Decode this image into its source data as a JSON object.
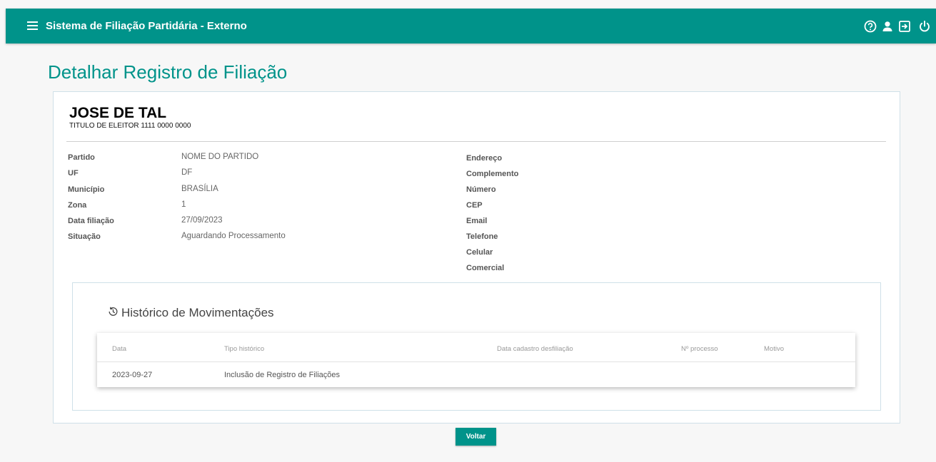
{
  "header": {
    "title": "Sistema de Filiação Partidária - Externo",
    "icons": [
      "menu-icon",
      "help-icon",
      "user-icon",
      "exit-icon",
      "power-icon"
    ]
  },
  "page": {
    "title": "Detalhar Registro de Filiação"
  },
  "person": {
    "name": "JOSE DE TAL",
    "doc": "TITULO DE ELEITOR 1111 0000 0000"
  },
  "details_left": [
    {
      "label": "Partido",
      "value": "NOME DO PARTIDO"
    },
    {
      "label": "UF",
      "value": "DF"
    },
    {
      "label": "Município",
      "value": "BRASÍLIA"
    },
    {
      "label": "Zona",
      "value": "1"
    },
    {
      "label": "Data filiação",
      "value": "27/09/2023"
    },
    {
      "label": "Situação",
      "value": "Aguardando Processamento"
    }
  ],
  "details_right": [
    {
      "label": "Endereço"
    },
    {
      "label": "Complemento"
    },
    {
      "label": "Número"
    },
    {
      "label": "CEP"
    },
    {
      "label": "Email"
    },
    {
      "label": "Telefone"
    },
    {
      "label": "Celular"
    },
    {
      "label": "Comercial"
    }
  ],
  "history": {
    "title": "Histórico de Movimentações",
    "columns": [
      "Data",
      "Tipo histórico",
      "Data cadastro desfiliação",
      "Nº processo",
      "Motivo"
    ],
    "rows": [
      [
        "2023-09-27",
        "Inclusão de Registro de Filiações",
        "",
        "",
        ""
      ]
    ]
  },
  "actions": {
    "voltar_label": "Voltar"
  },
  "colors": {
    "primary": "#00938a",
    "border": "#cfe0e8",
    "background": "#f7f7f7"
  }
}
